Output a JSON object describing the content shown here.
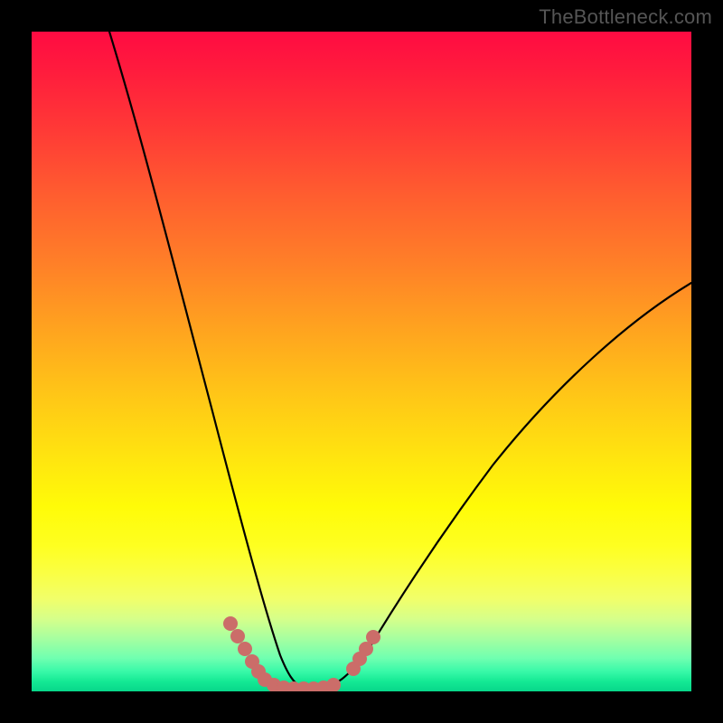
{
  "watermark": {
    "text": "TheBottleneck.com"
  },
  "chart_data": {
    "type": "line",
    "title": "",
    "xlabel": "",
    "ylabel": "",
    "xlim": [
      0,
      100
    ],
    "ylim": [
      0,
      100
    ],
    "grid": false,
    "legend": false,
    "series": [
      {
        "name": "bottleneck-curve",
        "x": [
          0,
          4,
          8,
          12,
          16,
          20,
          24,
          28,
          30,
          32,
          33,
          34,
          35,
          36,
          37,
          38,
          39,
          40,
          41,
          42,
          43,
          44,
          46,
          50,
          55,
          60,
          66,
          74,
          82,
          90,
          100
        ],
        "values": [
          108,
          100,
          90,
          79,
          68,
          57,
          46,
          34,
          28,
          22,
          19,
          16,
          13,
          10,
          7,
          4,
          2,
          1,
          0,
          0,
          0,
          1,
          3,
          7,
          13,
          19,
          26,
          35,
          43,
          50,
          58
        ]
      },
      {
        "name": "marker-cluster-left",
        "x": [
          30,
          31,
          32,
          33,
          33.5,
          34
        ],
        "values": [
          8,
          7,
          6,
          5,
          4,
          3
        ]
      },
      {
        "name": "marker-cluster-bottom",
        "x": [
          36,
          37.5,
          39,
          40.5,
          42,
          43.5,
          45
        ],
        "values": [
          0.5,
          0.3,
          0.2,
          0.2,
          0.2,
          0.3,
          0.5
        ]
      },
      {
        "name": "marker-cluster-right",
        "x": [
          48,
          49,
          50,
          51
        ],
        "values": [
          3,
          4,
          5,
          7
        ]
      }
    ],
    "colors": {
      "curve": "#000000",
      "markers": "#cb6d69",
      "gradient_top": "#ff0b42",
      "gradient_bottom": "#07d78a"
    }
  }
}
